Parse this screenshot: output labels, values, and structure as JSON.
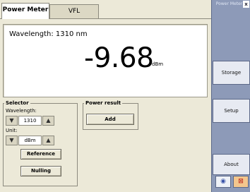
{
  "tabs": [
    {
      "label": "Power Meter",
      "active": true
    },
    {
      "label": "VFL",
      "active": false
    }
  ],
  "display": {
    "wavelength_text": "Wavelength: 1310 nm",
    "reading": "-9.68",
    "unit": "dBm"
  },
  "selector": {
    "title": "Selector",
    "wavelength_label": "Wavelength:",
    "wavelength_value": "1310",
    "unit_label": "Unit:",
    "unit_value": "dBm",
    "reference_label": "Reference",
    "nulling_label": "Nulling"
  },
  "power_result": {
    "title": "Power result",
    "add_label": "Add"
  },
  "sidebar": {
    "title": "Power Meter",
    "close_glyph": "x",
    "storage_label": "Storage",
    "setup_label": "Setup",
    "about_label": "About",
    "help_icon": "help-icon",
    "exit_icon": "exit-icon",
    "help_glyph": "◉",
    "exit_glyph": "⊠"
  },
  "icons": {
    "down_arrow": "▼",
    "up_arrow": "▲"
  }
}
